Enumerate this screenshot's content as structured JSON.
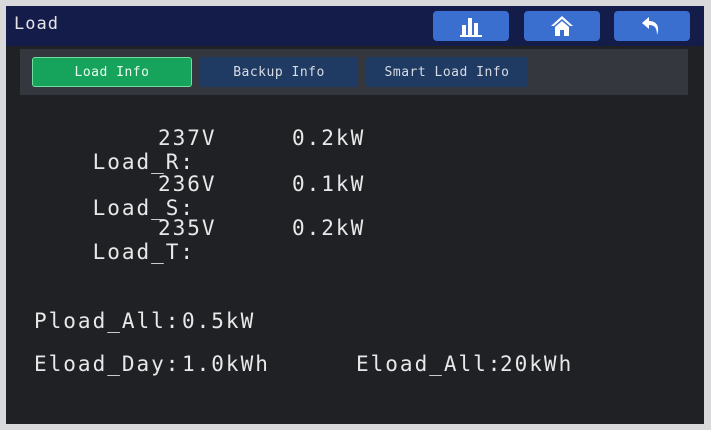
{
  "header": {
    "title": "Load",
    "buttons": [
      {
        "name": "stats",
        "icon": "bar-chart-icon"
      },
      {
        "name": "home",
        "icon": "home-icon"
      },
      {
        "name": "back",
        "icon": "return-arrow-icon"
      }
    ]
  },
  "tabs": [
    {
      "label": "Load Info",
      "active": true
    },
    {
      "label": "Backup Info",
      "active": false
    },
    {
      "label": "Smart Load Info",
      "active": false
    }
  ],
  "phases": [
    {
      "label": "Load_R:",
      "voltage": "237V",
      "power": "0.2kW"
    },
    {
      "label": "Load_S:",
      "voltage": "236V",
      "power": "0.1kW"
    },
    {
      "label": "Load_T:",
      "voltage": "235V",
      "power": "0.2kW"
    }
  ],
  "summary": {
    "pload_all_label": "Pload_All:",
    "pload_all_value": "0.5kW",
    "eload_day_label": "Eload_Day:",
    "eload_day_value": "1.0kWh",
    "eload_all_label": "Eload_All:",
    "eload_all_value": "20kWh"
  },
  "colors": {
    "header_bg": "#141c4a",
    "button_bg": "#3b6fcf",
    "active_tab": "#16a35c",
    "inactive_tab": "#1f3b64",
    "screen_bg": "#1f2124"
  }
}
